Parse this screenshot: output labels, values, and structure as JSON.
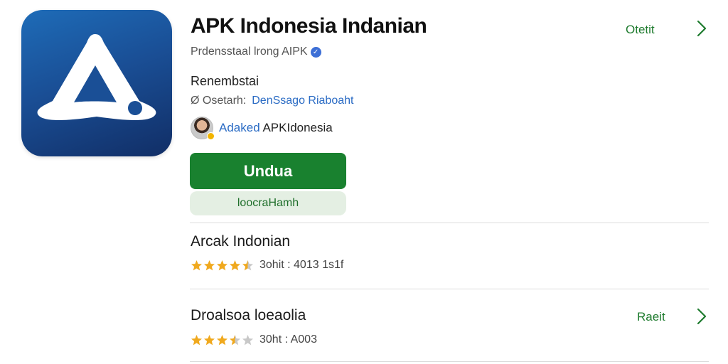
{
  "app": {
    "title": "APK Indonesia Indanian",
    "subtitle": "Prdensstaal lrong AIPK",
    "category": "Renembstai",
    "meta_label": "Ø Osetarh:",
    "meta_link": "DenSsago Riaboaht",
    "developer_link": "Adaked",
    "developer_name": " APKIdonesia",
    "top_link": "Otetit"
  },
  "actions": {
    "primary_label": "Undua",
    "secondary_label": "loocraHamh"
  },
  "list": [
    {
      "title": "Arcak Indonian",
      "rating": 4.5,
      "rating_text": "3ohit : 4013 1s1f",
      "link": ""
    },
    {
      "title": "Droalsoa loeaolia",
      "rating": 3.5,
      "rating_text": "30ht : A003",
      "link": "Raeit"
    }
  ],
  "colors": {
    "accent_green": "#19812f",
    "link_blue": "#2a6bc4",
    "star_gold": "#f0a91e",
    "icon_blue": "#1a4f96"
  },
  "icons": {
    "app_logo": "a-logo-icon",
    "verified": "verified-badge-icon",
    "chevron": "chevron-right-icon",
    "star": "star-icon"
  }
}
